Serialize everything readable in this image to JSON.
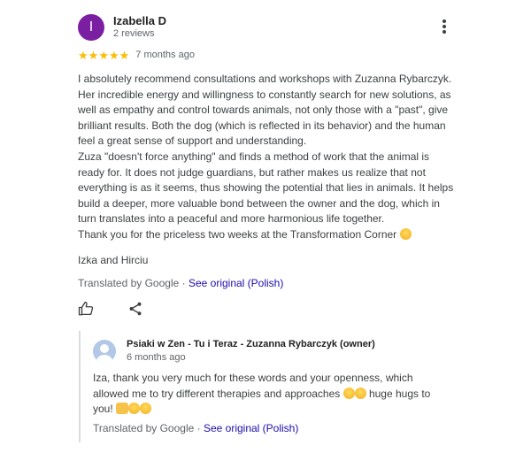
{
  "review": {
    "author": "Izabella D",
    "avatar_letter": "I",
    "reviews_count": "2 reviews",
    "stars": [
      "★",
      "★",
      "★",
      "★",
      "★"
    ],
    "date": "7 months ago",
    "lines": [
      "I absolutely recommend consultations and workshops with Zuzanna Rybarczyk. Her incredible energy and willingness to constantly search for new solutions, as well as empathy and control towards animals, not only those with a \"past\", give brilliant results. Both the dog (which is reflected in its behavior) and the human feel a great sense of support and understanding.",
      "Zuza \"doesn't force anything\" and finds a method of work that the animal is ready for. It does not judge guardians, but rather makes us realize that not everything is as it seems, thus showing the potential that lies in animals. It helps build a deeper, more valuable bond between the owner and the dog, which in turn translates into a peaceful and more harmonious life together.",
      "Thank you for the priceless two weeks at the Transformation Corner"
    ],
    "signoff": "Izka and Hirciu",
    "translated_prefix": "Translated by Google",
    "separator": " · ",
    "see_original": "See original (Polish)",
    "icons": {
      "menu": "more-vert-icon",
      "like": "thumb-up-icon",
      "share": "share-icon"
    }
  },
  "reply": {
    "owner_name": "Psiaki w Zen - Tu i Teraz - Zuzanna Rybarczyk (owner)",
    "date": "6 months ago",
    "text_part1": "Iza, thank you very much for these words and your openness, which allowed me to try different therapies and approaches",
    "text_part2": " huge hugs to you!",
    "translated_prefix": "Translated by Google",
    "separator": " · ",
    "see_original": "See original (Polish)"
  },
  "colors": {
    "avatar": "#7b1fa2",
    "star": "#fbbc04",
    "link": "#1a0dab"
  }
}
